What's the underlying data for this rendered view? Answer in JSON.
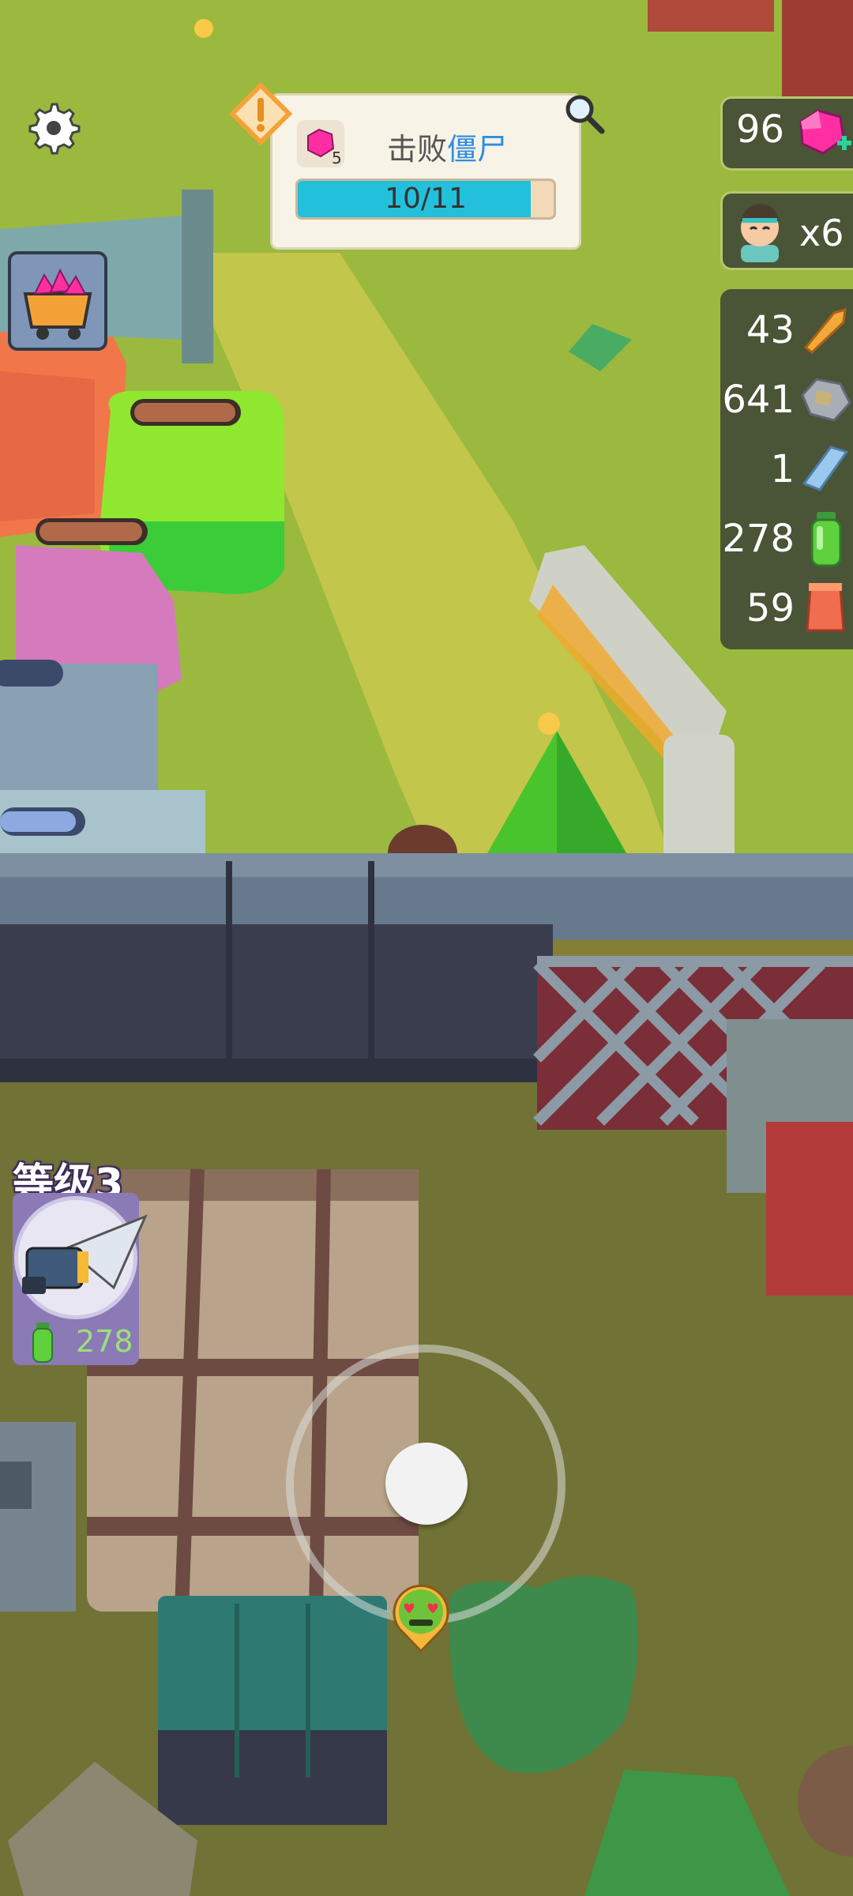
{
  "hud": {
    "settings_icon": "gear-icon",
    "cart_icon": "gem-cart-icon",
    "quest": {
      "title_prefix": "击败",
      "title_highlight": "僵尸",
      "gem_count": "5",
      "progress_text": "10/11",
      "progress_value": 0.909,
      "alert_icon": "exclamation-icon",
      "search_icon": "magnifier-icon"
    },
    "gems": {
      "value": "96",
      "icon": "pink-gem-plus-icon"
    },
    "characters": {
      "value": "x6",
      "icon": "survivor-face-icon"
    },
    "resources": [
      {
        "value": "43",
        "icon": "bullet-icon",
        "color": "#f3a93a"
      },
      {
        "value": "641",
        "icon": "scrap-metal-icon",
        "color": "#a7aeb5"
      },
      {
        "value": "1",
        "icon": "crystal-bar-icon",
        "color": "#9bc8ef"
      },
      {
        "value": "278",
        "icon": "green-potion-icon",
        "color": "#5ed13d"
      },
      {
        "value": "59",
        "icon": "orange-canister-icon",
        "color": "#f06e4f"
      }
    ],
    "weapon": {
      "level_label": "等级3",
      "ammo": "278",
      "icon": "drill-gun-icon",
      "ammo_icon": "green-potion-icon"
    },
    "joystick": {
      "icon": "joystick-icon"
    },
    "marker": {
      "icon": "zombie-heart-eyes-icon"
    }
  },
  "colors": {
    "grass": "#9ab93e",
    "path": "#c7c64c",
    "wall": "#3a3d4e",
    "accent_cyan": "#23c0db",
    "gem_pink": "#ff2fa3"
  }
}
